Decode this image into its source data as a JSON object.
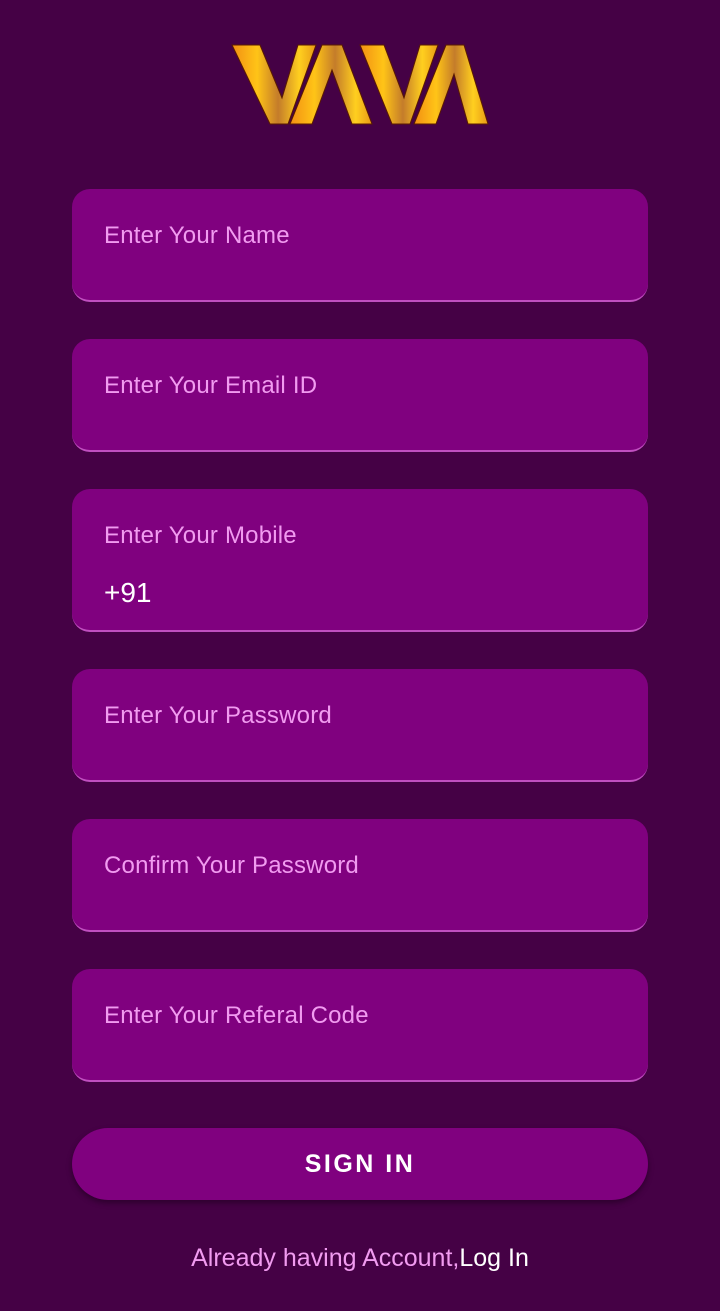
{
  "app": {
    "logo_text": "VAVA"
  },
  "form": {
    "name_placeholder": "Enter Your Name",
    "email_placeholder": "Enter Your Email ID",
    "mobile_placeholder": "Enter Your Mobile",
    "mobile_prefix": "+91",
    "password_placeholder": "Enter Your Password",
    "confirm_password_placeholder": "Confirm Your Password",
    "referral_placeholder": "Enter Your Referal Code"
  },
  "actions": {
    "signin_label": "SIGN IN",
    "login_prompt": "Already having Account,",
    "login_link": "Log In"
  },
  "colors": {
    "background": "#450145",
    "field_background": "#80017f",
    "placeholder": "#f19bf0",
    "logo_gold": "#f5b51c"
  }
}
